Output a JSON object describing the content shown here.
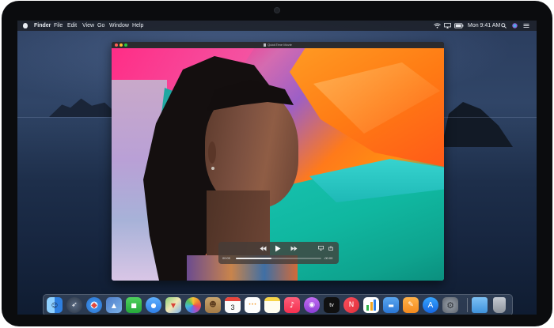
{
  "menubar": {
    "app_name": "Finder",
    "items": [
      "File",
      "Edit",
      "View",
      "Go",
      "Window",
      "Help"
    ],
    "clock": "Mon 9:41 AM",
    "icons": [
      "wifi-icon",
      "airplay-icon",
      "battery-icon",
      "search-icon",
      "siri-icon",
      "control-center-icon"
    ]
  },
  "window": {
    "title": "QuickTime Movie",
    "traffic_colors": [
      "#ff5f57",
      "#febc2e",
      "#28c840"
    ]
  },
  "player": {
    "elapsed": "00:00",
    "remaining": "-00:00",
    "progress": 0.42
  },
  "dock": {
    "apps": [
      "finder-icon",
      "launchpad-icon",
      "safari-icon",
      "photos-app-icon",
      "facetime-icon",
      "messages-icon",
      "maps-icon",
      "photos-icon",
      "contacts-icon",
      "calendar-icon",
      "reminders-icon",
      "notes-icon",
      "music-icon",
      "podcasts-icon",
      "apple-tv-icon",
      "news-icon",
      "numbers-icon",
      "keynote-icon",
      "pages-icon",
      "app-store-icon",
      "system-preferences-icon"
    ],
    "calendar_day": "3",
    "tv_label": "tv",
    "right_items": [
      "downloads-folder-icon",
      "trash-icon"
    ]
  },
  "colors": {
    "menubar_bg": "#1c2028",
    "desktop_sky": "#304567",
    "desktop_sea": "#172640"
  }
}
